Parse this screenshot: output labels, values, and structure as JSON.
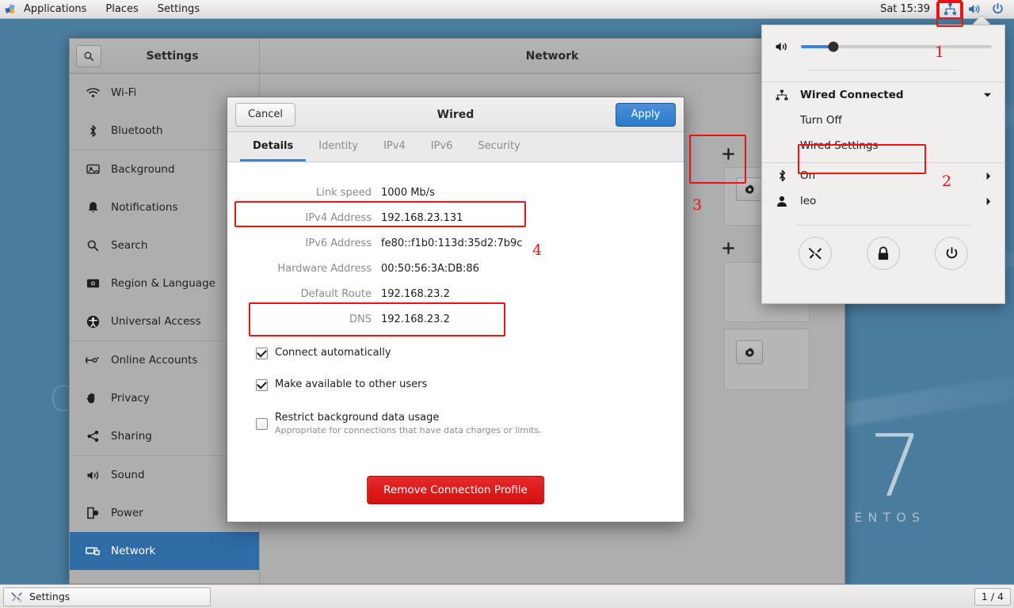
{
  "topbar": {
    "apps_label": "Applications",
    "places_label": "Places",
    "settings_label": "Settings",
    "clock": "Sat 15:39",
    "tray": {
      "network_icon": "wired-network-icon",
      "volume_icon": "volume-high-icon",
      "power_icon": "power-icon"
    }
  },
  "settings_window": {
    "app_title": "Settings",
    "page_title": "Network",
    "search_icon": "search-icon",
    "sidebar": [
      {
        "label": "Wi-Fi",
        "icon": "wifi-icon",
        "selected": false
      },
      {
        "label": "Bluetooth",
        "icon": "bluetooth-icon",
        "selected": false
      },
      {
        "label": "Background",
        "icon": "background-icon",
        "selected": false
      },
      {
        "label": "Notifications",
        "icon": "bell-icon",
        "selected": false
      },
      {
        "label": "Search",
        "icon": "search-icon",
        "selected": false
      },
      {
        "label": "Region & Language",
        "icon": "region-icon",
        "selected": false
      },
      {
        "label": "Universal Access",
        "icon": "accessibility-icon",
        "selected": false
      },
      {
        "label": "Online Accounts",
        "icon": "online-accounts-icon",
        "selected": false
      },
      {
        "label": "Privacy",
        "icon": "hand-icon",
        "selected": false
      },
      {
        "label": "Sharing",
        "icon": "share-icon",
        "selected": false
      },
      {
        "label": "Sound",
        "icon": "speaker-icon",
        "selected": false
      },
      {
        "label": "Power",
        "icon": "power-plug-icon",
        "selected": false
      },
      {
        "label": "Network",
        "icon": "network-icon",
        "selected": true
      }
    ],
    "content": {
      "add_button_icon": "plus-icon",
      "settings_gear_icon": "gear-icon"
    }
  },
  "wired_dialog": {
    "title": "Wired",
    "cancel_label": "Cancel",
    "apply_label": "Apply",
    "tabs": [
      {
        "label": "Details",
        "active": true
      },
      {
        "label": "Identity",
        "active": false
      },
      {
        "label": "IPv4",
        "active": false
      },
      {
        "label": "IPv6",
        "active": false
      },
      {
        "label": "Security",
        "active": false
      }
    ],
    "details": [
      {
        "label": "Link speed",
        "value": "1000 Mb/s"
      },
      {
        "label": "IPv4 Address",
        "value": "192.168.23.131"
      },
      {
        "label": "IPv6 Address",
        "value": "fe80::f1b0:113d:35d2:7b9c"
      },
      {
        "label": "Hardware Address",
        "value": "00:50:56:3A:DB:86"
      },
      {
        "label": "Default Route",
        "value": "192.168.23.2"
      },
      {
        "label": "DNS",
        "value": "192.168.23.2"
      }
    ],
    "checkboxes": [
      {
        "label": "Connect automatically",
        "checked": true,
        "sub": ""
      },
      {
        "label": "Make available to other users",
        "checked": true,
        "sub": ""
      },
      {
        "label": "Restrict background data usage",
        "checked": false,
        "sub": "Appropriate for connections that have data charges or limits."
      }
    ],
    "remove_label": "Remove Connection Profile"
  },
  "system_menu": {
    "volume_icon": "volume-icon",
    "volume_percent": 17,
    "network_row": {
      "label": "Wired Connected",
      "icon": "wired-network-icon",
      "expander": "chevron-down-icon"
    },
    "network_sub": [
      {
        "label": "Turn Off"
      },
      {
        "label": "Wired Settings"
      }
    ],
    "rows": [
      {
        "label": "On",
        "icon": "bluetooth-icon",
        "expander": "chevron-right-icon"
      },
      {
        "label": "leo",
        "icon": "user-icon",
        "expander": "chevron-right-icon"
      }
    ],
    "actions": [
      {
        "icon": "tools-settings-icon",
        "name": "settings-action"
      },
      {
        "icon": "lock-icon",
        "name": "lock-action"
      },
      {
        "icon": "power-icon",
        "name": "power-action"
      }
    ]
  },
  "taskbar": {
    "task_label": "Settings",
    "task_icon": "tools-settings-icon",
    "workspace": "1 / 4"
  },
  "desktop": {
    "watermark_number": "7",
    "watermark_word": "ENTOS",
    "watermark_c": "C"
  },
  "annotations": {
    "markers": [
      "1",
      "2",
      "3",
      "4"
    ],
    "color": "#ee1111"
  }
}
